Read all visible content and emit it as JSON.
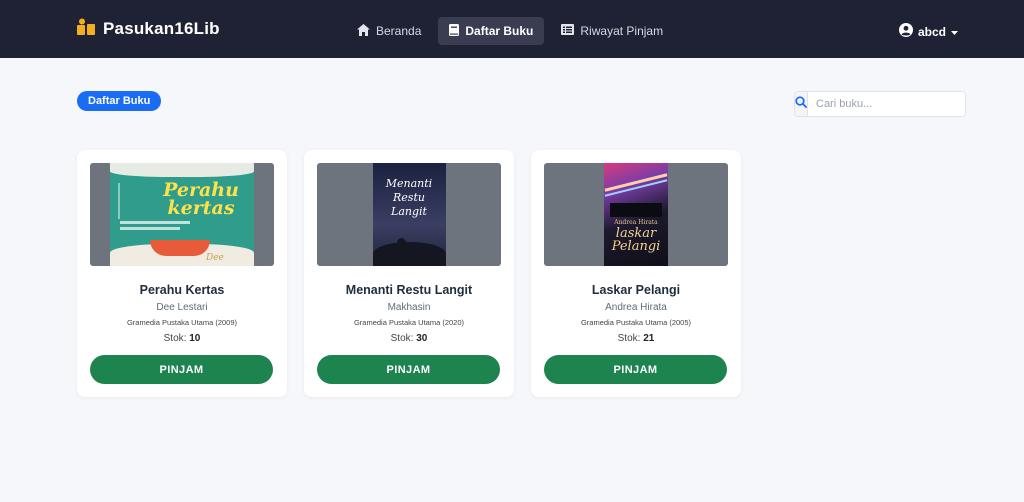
{
  "header": {
    "brand": "Pasukan16Lib",
    "nav": [
      {
        "label": "Beranda",
        "icon": "home-icon",
        "active": false
      },
      {
        "label": "Daftar Buku",
        "icon": "book-icon",
        "active": true
      },
      {
        "label": "Riwayat Pinjam",
        "icon": "list-icon",
        "active": false
      }
    ],
    "user": "abcd"
  },
  "page": {
    "badge": "Daftar Buku",
    "search_placeholder": "Cari buku..."
  },
  "books": [
    {
      "title": "Perahu Kertas",
      "author": "Dee Lestari",
      "publisher": "Gramedia Pustaka Utama (2009)",
      "stock_label": "Stok:",
      "stock": "10",
      "button": "PINJAM",
      "cover_title": "Perahu kertas",
      "cover_sub": "Dee"
    },
    {
      "title": "Menanti Restu Langit",
      "author": "Makhasin",
      "publisher": "Gramedia Pustaka Utama (2020)",
      "stock_label": "Stok:",
      "stock": "30",
      "button": "PINJAM",
      "cover_title": "Menanti Restu Langit",
      "cover_sub": ""
    },
    {
      "title": "Laskar Pelangi",
      "author": "Andrea Hirata",
      "publisher": "Gramedia Pustaka Utama (2005)",
      "stock_label": "Stok:",
      "stock": "21",
      "button": "PINJAM",
      "cover_title": "laskar Pelangi",
      "cover_sub": "Andrea Hirata"
    }
  ],
  "colors": {
    "navbar": "#1f2235",
    "primary": "#1a6cf5",
    "success": "#1d8450",
    "brand_icon": "#f2b01e"
  }
}
